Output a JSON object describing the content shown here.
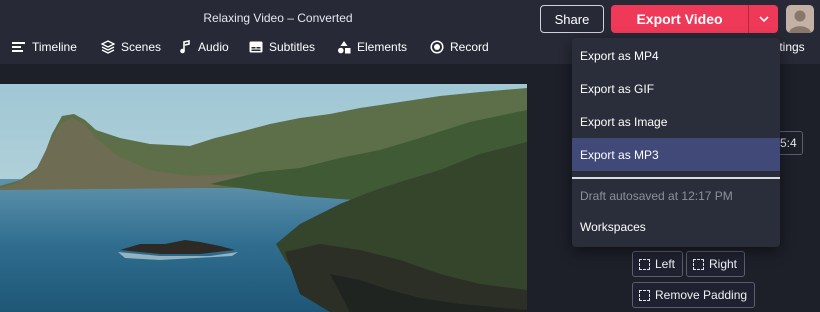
{
  "header": {
    "title": "Relaxing Video – Converted",
    "share_label": "Share",
    "export_label": "Export Video",
    "export_caret_icon": "chevron-down-icon",
    "avatar_icon": "user-avatar",
    "accent_color": "#ee3958"
  },
  "nav": {
    "items": [
      {
        "label": "Timeline",
        "icon": "timeline-icon"
      },
      {
        "label": "Scenes",
        "icon": "layers-icon"
      },
      {
        "label": "Audio",
        "icon": "music-note-icon"
      },
      {
        "label": "Subtitles",
        "icon": "subtitles-icon"
      },
      {
        "label": "Elements",
        "icon": "shapes-icon"
      },
      {
        "label": "Record",
        "icon": "record-icon"
      }
    ],
    "settings_peek": "ttings"
  },
  "export_menu": {
    "items": [
      "Export as MP4",
      "Export as GIF",
      "Export as Image",
      "Export as MP3"
    ],
    "active_index": 3,
    "draft_note": "Draft autosaved at 12:17 PM",
    "workspaces_label": "Workspaces",
    "highlight_color": "#414978"
  },
  "side_panel": {
    "ratio_peek": "5:4",
    "align_left": "Left",
    "align_right": "Right",
    "remove_padding": "Remove Padding"
  }
}
